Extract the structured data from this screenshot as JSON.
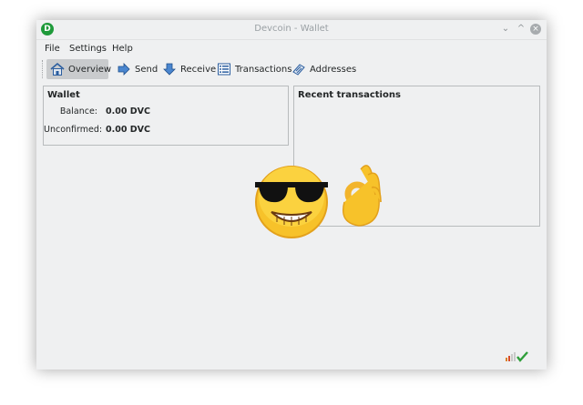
{
  "window": {
    "title": "Devcoin - Wallet",
    "app_icon_letter": "D",
    "minimize_glyph": "⌄",
    "maximize_glyph": "^",
    "close_glyph": "×"
  },
  "menu": [
    "File",
    "Settings",
    "Help"
  ],
  "toolbar": [
    {
      "label": "Overview",
      "icon": "home-icon",
      "active": true
    },
    {
      "label": "Send",
      "icon": "send-arrow-icon",
      "active": false
    },
    {
      "label": "Receive",
      "icon": "receive-arrow-icon",
      "active": false
    },
    {
      "label": "Transactions",
      "icon": "list-icon",
      "active": false
    },
    {
      "label": "Addresses",
      "icon": "address-book-icon",
      "active": false
    }
  ],
  "wallet": {
    "title": "Wallet",
    "balance_label": "Balance:",
    "balance_value": "0.00 DVC",
    "unconfirmed_label": "Unconfirmed:",
    "unconfirmed_value": "0.00 DVC"
  },
  "recent": {
    "title": "Recent transactions"
  },
  "status": {
    "signal_icon": "signal-bars-icon",
    "sync_icon": "checkmark-icon"
  },
  "overlay": {
    "emojis": [
      "sunglasses-grin-emoji",
      "ok-hand-emoji"
    ]
  }
}
